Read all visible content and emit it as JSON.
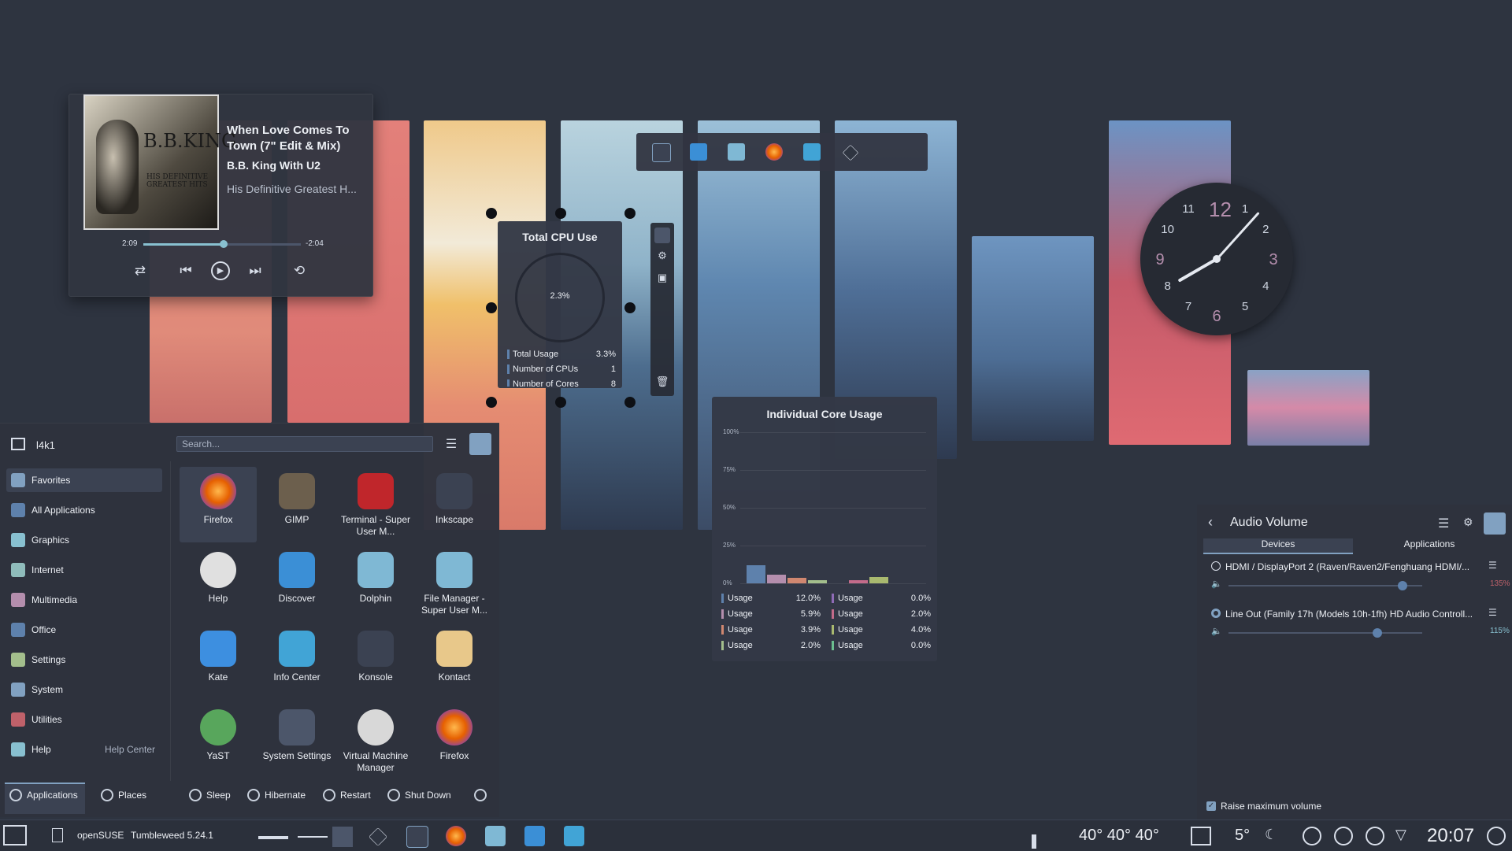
{
  "media_player": {
    "title": "When Love Comes To Town (7\" Edit & Mix)",
    "artist": "B.B. King With U2",
    "album": "His Definitive Greatest H...",
    "cover_text": "B.B.KING",
    "cover_subtext": "HIS DEFINITIVE GREATEST HITS",
    "elapsed": "2:09",
    "remaining": "-2:04",
    "progress": 0.51,
    "buttons": {
      "shuffle": "shuffle-icon",
      "previous": "previous-icon",
      "play": "play-icon",
      "next": "next-icon",
      "repeat": "repeat-icon"
    }
  },
  "dock": {
    "icons": [
      "system-settings-icon",
      "discover-icon",
      "dolphin-icon",
      "firefox-icon",
      "info-center-icon",
      "inkscape-icon"
    ]
  },
  "cpu_widget": {
    "title": "Total CPU Use",
    "gauge_value": "2.3%",
    "rows": [
      {
        "label": "Total Usage",
        "value": "3.3%"
      },
      {
        "label": "Number of CPUs",
        "value": "1"
      },
      {
        "label": "Number of Cores",
        "value": "8"
      }
    ]
  },
  "core_widget": {
    "title": "Individual Core Usage",
    "y_ticks": [
      "100%",
      "75%",
      "50%",
      "25%",
      "0%"
    ],
    "core_values": [
      12.0,
      5.9,
      3.9,
      2.0,
      0.0,
      2.0,
      4.0,
      0.0
    ],
    "core_colors": [
      "#5e81ac",
      "#b48ead",
      "#d08770",
      "#a3be8c",
      "#8f6bb6",
      "#c36b8a",
      "#a9b96f",
      "#6bbf8f"
    ],
    "legend": [
      {
        "label": "Usage",
        "value": "12.0%"
      },
      {
        "label": "Usage",
        "value": "0.0%"
      },
      {
        "label": "Usage",
        "value": "5.9%"
      },
      {
        "label": "Usage",
        "value": "2.0%"
      },
      {
        "label": "Usage",
        "value": "3.9%"
      },
      {
        "label": "Usage",
        "value": "4.0%"
      },
      {
        "label": "Usage",
        "value": "2.0%"
      },
      {
        "label": "Usage",
        "value": "0.0%"
      }
    ]
  },
  "clock": {
    "numbers": [
      "12",
      "1",
      "2",
      "3",
      "4",
      "5",
      "6",
      "7",
      "8",
      "9",
      "10",
      "11"
    ],
    "time": "20:07"
  },
  "launcher": {
    "user": "l4k1",
    "search_placeholder": "Search...",
    "categories": [
      {
        "label": "Favorites",
        "icon": "favorites-icon"
      },
      {
        "label": "All Applications",
        "icon": "all-applications-icon"
      },
      {
        "label": "Graphics",
        "icon": "graphics-icon"
      },
      {
        "label": "Internet",
        "icon": "internet-icon"
      },
      {
        "label": "Multimedia",
        "icon": "multimedia-icon"
      },
      {
        "label": "Office",
        "icon": "office-icon"
      },
      {
        "label": "Settings",
        "icon": "settings-icon"
      },
      {
        "label": "System",
        "icon": "system-icon"
      },
      {
        "label": "Utilities",
        "icon": "utilities-icon"
      },
      {
        "label": "Help",
        "icon": "help-icon"
      }
    ],
    "help_center": "Help Center",
    "apps": [
      {
        "label": "Firefox",
        "icon": "firefox-icon"
      },
      {
        "label": "GIMP",
        "icon": "gimp-icon"
      },
      {
        "label": "Terminal - Super User M...",
        "icon": "terminal-icon"
      },
      {
        "label": "Inkscape",
        "icon": "inkscape-icon"
      },
      {
        "label": "Help",
        "icon": "help-icon"
      },
      {
        "label": "Discover",
        "icon": "discover-icon"
      },
      {
        "label": "Dolphin",
        "icon": "dolphin-icon"
      },
      {
        "label": "File Manager - Super User M...",
        "icon": "file-manager-icon"
      },
      {
        "label": "Kate",
        "icon": "kate-icon"
      },
      {
        "label": "Info Center",
        "icon": "info-center-icon"
      },
      {
        "label": "Konsole",
        "icon": "konsole-icon"
      },
      {
        "label": "Kontact",
        "icon": "kontact-icon"
      },
      {
        "label": "YaST",
        "icon": "yast-icon"
      },
      {
        "label": "System Settings",
        "icon": "system-settings-icon"
      },
      {
        "label": "Virtual Machine Manager",
        "icon": "virtual-machine-manager-icon"
      },
      {
        "label": "Firefox",
        "icon": "firefox-icon"
      }
    ],
    "footer": {
      "applications": "Applications",
      "places": "Places",
      "sleep": "Sleep",
      "hibernate": "Hibernate",
      "restart": "Restart",
      "shutdown": "Shut Down"
    }
  },
  "audio": {
    "title": "Audio Volume",
    "tabs": [
      "Devices",
      "Applications"
    ],
    "devices": [
      {
        "name": "HDMI / DisplayPort 2 (Raven/Raven2/Fenghuang HDMI/...",
        "percent": "135%",
        "level": 1.35
      },
      {
        "name": "Line Out (Family 17h (Models 10h-1fh) HD Audio Controll...",
        "percent": "115%",
        "level": 1.15
      }
    ],
    "raise_max": "Raise maximum volume"
  },
  "taskbar": {
    "distro": "openSUSE",
    "version": "Tumbleweed 5.24.1",
    "temps": "40° 40° 40°",
    "weather": "5°",
    "time": "20:07"
  },
  "colors": {
    "accent": "#5e81ac",
    "background": "#2e3440",
    "over_volume": "#bf616a"
  }
}
